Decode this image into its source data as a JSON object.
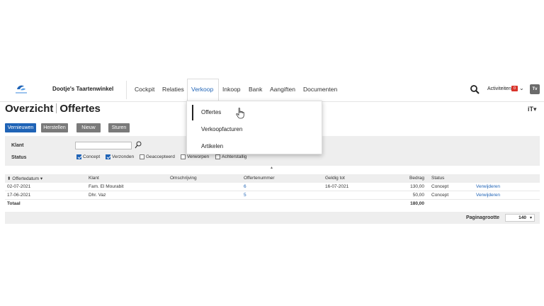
{
  "header": {
    "shop_name": "Dootje's Taartenwinkel",
    "nav": [
      {
        "label": "Cockpit",
        "active": false
      },
      {
        "label": "Relaties",
        "active": false
      },
      {
        "label": "Verkoop",
        "active": true
      },
      {
        "label": "Inkoop",
        "active": false
      },
      {
        "label": "Bank",
        "active": false
      },
      {
        "label": "Aangiften",
        "active": false
      },
      {
        "label": "Documenten",
        "active": false
      }
    ],
    "activities_label": "Activiteiten",
    "activities_count": "0",
    "avatar_initials": "Tv",
    "accent_color": "#1f63b6"
  },
  "page": {
    "title_part1": "Overzicht",
    "title_part2": "Offertes"
  },
  "toolbar": {
    "refresh_label": "Vernieuwen",
    "reset_label": "Herstellen",
    "new_label": "Nieuw",
    "send_label": "Sturen"
  },
  "filters": {
    "client_label": "Klant",
    "client_value": "",
    "status_label": "Status",
    "statuses": [
      {
        "label": "Concept",
        "checked": true
      },
      {
        "label": "Verzonden",
        "checked": true
      },
      {
        "label": "Geaccepteerd",
        "checked": false
      },
      {
        "label": "Verworpen",
        "checked": false
      },
      {
        "label": "Achterstallig",
        "checked": false
      }
    ]
  },
  "table": {
    "columns": [
      "Offertedatum",
      "Klant",
      "Omschrijving",
      "Offertenummer",
      "Geldig tot",
      "Bedrag",
      "Status",
      ""
    ],
    "rows": [
      {
        "date": "02-07-2021",
        "client": "Fam. El Mourabit",
        "description": "",
        "number": "6",
        "valid_until": "16-07-2021",
        "amount": "130,00",
        "status": "Concept",
        "action": "Verwijderen"
      },
      {
        "date": "17-06-2021",
        "client": "Dhr. Vaz",
        "description": "",
        "number": "5",
        "valid_until": "",
        "amount": "50,00",
        "status": "Concept",
        "action": "Verwijderen"
      }
    ],
    "total_label": "Totaal",
    "total_amount": "180,00",
    "page_size_label": "Paginagrootte",
    "page_size_value": "140"
  },
  "dropdown": {
    "items": [
      "Offertes",
      "Verkoopfacturen",
      "Artikelen"
    ],
    "selected_index": 0
  }
}
